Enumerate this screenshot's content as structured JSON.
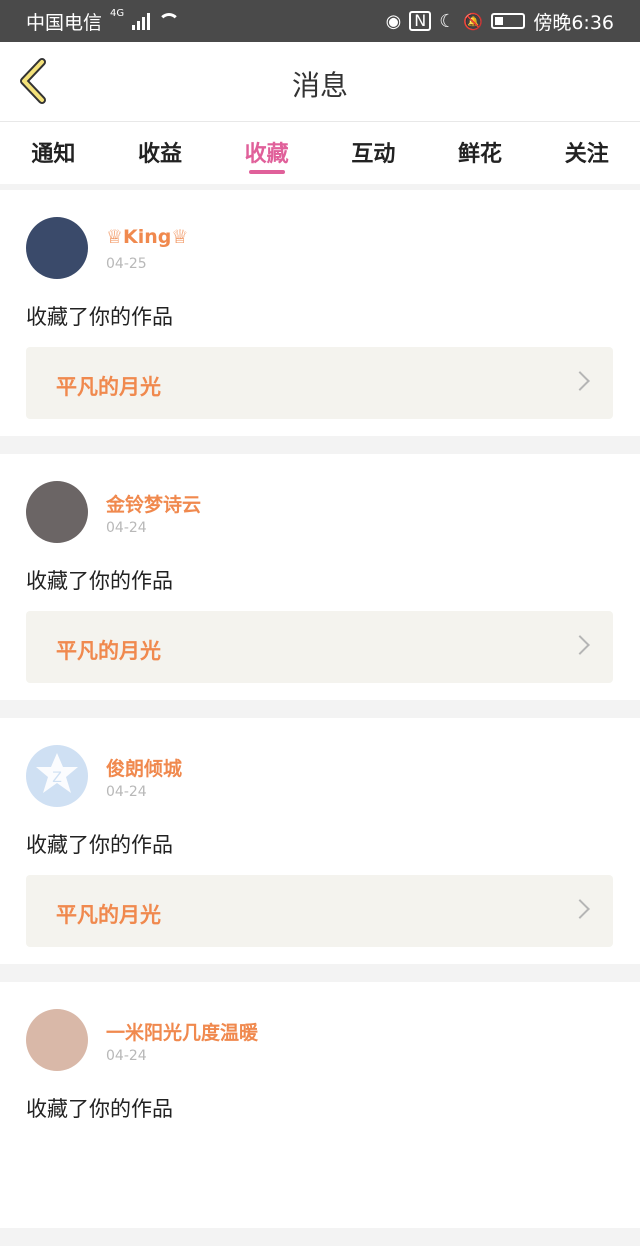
{
  "status": {
    "carrier": "中国电信",
    "network": "4G",
    "time": "傍晚6:36"
  },
  "header": {
    "title": "消息"
  },
  "tabs": [
    {
      "label": "通知",
      "active": false
    },
    {
      "label": "收益",
      "active": false
    },
    {
      "label": "收藏",
      "active": true
    },
    {
      "label": "互动",
      "active": false
    },
    {
      "label": "鲜花",
      "active": false
    },
    {
      "label": "关注",
      "active": false
    }
  ],
  "colors": {
    "accent": "#e0609a",
    "name": "#f0894e",
    "statusbar": "#4a4a4a"
  },
  "items": [
    {
      "name": "♕King♕",
      "date": "04-25",
      "message": "收藏了你的作品",
      "work": "平凡的月光",
      "avatar_color": "#3a4a6a"
    },
    {
      "name": "金铃梦诗云",
      "date": "04-24",
      "message": "收藏了你的作品",
      "work": "平凡的月光",
      "avatar_color": "#6b6565"
    },
    {
      "name": "俊朗倾城",
      "date": "04-24",
      "message": "收藏了你的作品",
      "work": "平凡的月光",
      "avatar_color": "#cfe0f3"
    },
    {
      "name": "一米阳光几度温暖",
      "date": "04-24",
      "message": "收藏了你的作品",
      "work": "",
      "avatar_color": "#d9b8a8"
    }
  ]
}
